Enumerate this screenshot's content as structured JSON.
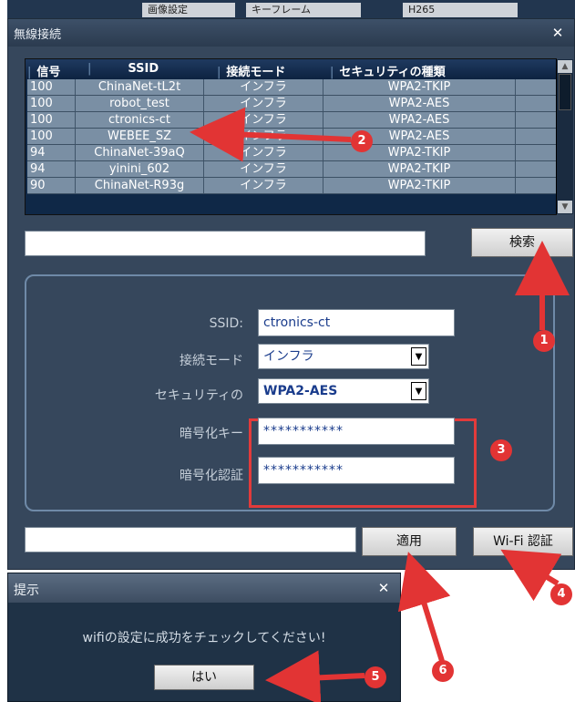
{
  "background_window": {
    "cell1": "画像設定",
    "cell2": "キーフレーム",
    "cell3": "H265"
  },
  "dialog": {
    "title": "無線接続",
    "close": "✕",
    "table": {
      "headers": [
        "信号",
        "SSID",
        "接続モード",
        "セキュリティの種類"
      ],
      "rows": [
        {
          "signal": "100",
          "ssid": "ChinaNet-tL2t",
          "mode": "インフラ",
          "security": "WPA2-TKIP"
        },
        {
          "signal": "100",
          "ssid": "robot_test",
          "mode": "インフラ",
          "security": "WPA2-AES"
        },
        {
          "signal": "100",
          "ssid": "ctronics-ct",
          "mode": "インフラ",
          "security": "WPA2-AES"
        },
        {
          "signal": "100",
          "ssid": "WEBEE_SZ",
          "mode": "インフラ",
          "security": "WPA2-AES"
        },
        {
          "signal": "94",
          "ssid": "ChinaNet-39aQ",
          "mode": "インフラ",
          "security": "WPA2-TKIP"
        },
        {
          "signal": "94",
          "ssid": "yinini_602",
          "mode": "インフラ",
          "security": "WPA2-TKIP"
        },
        {
          "signal": "90",
          "ssid": "ChinaNet-R93g",
          "mode": "インフラ",
          "security": "WPA2-TKIP"
        }
      ]
    },
    "search_input": "",
    "search_button": "検索",
    "form": {
      "ssid_label": "SSID:",
      "ssid_value": "ctronics-ct",
      "mode_label": "接続モード",
      "mode_value": "インフラ",
      "security_label": "セキュリティの",
      "security_value": "WPA2-AES",
      "key_label": "暗号化キー",
      "key_value": "***********",
      "auth_label": "暗号化認証",
      "auth_value": "***********"
    },
    "status_input": "",
    "apply_button": "適用",
    "wifi_auth_button": "Wi-Fi 認証"
  },
  "prompt_dialog": {
    "title": "提示",
    "close": "✕",
    "message": "wifiの設定に成功をチェックしてください!",
    "ok_button": "はい"
  },
  "annotations": {
    "steps": [
      "1",
      "2",
      "3",
      "4",
      "5",
      "6"
    ],
    "color": "#e23434"
  }
}
